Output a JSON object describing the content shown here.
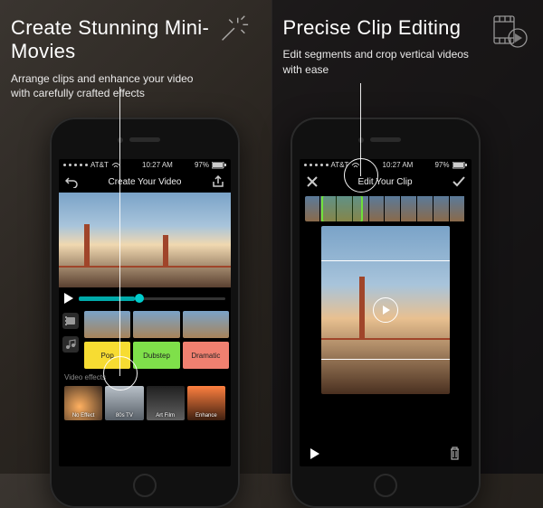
{
  "left": {
    "headline": "Create Stunning Mini-Movies",
    "subline": "Arrange clips and enhance your video with carefully crafted effects",
    "status": {
      "carrier": "AT&T",
      "time": "10:27 AM",
      "battery": "97%"
    },
    "nav": {
      "title": "Create Your Video"
    },
    "music": {
      "pop": "Pop",
      "dubstep": "Dubstep",
      "dramatic": "Dramatic"
    },
    "fx_section": "Video effects",
    "fx": {
      "no": "No Effect",
      "tv": "80s TV",
      "art": "Art Film",
      "enh": "Enhance"
    }
  },
  "right": {
    "headline": "Precise Clip Editing",
    "subline": "Edit segments and crop vertical videos with ease",
    "status": {
      "carrier": "AT&T",
      "time": "10:27 AM",
      "battery": "97%"
    },
    "nav": {
      "title": "Edit Your Clip"
    }
  }
}
